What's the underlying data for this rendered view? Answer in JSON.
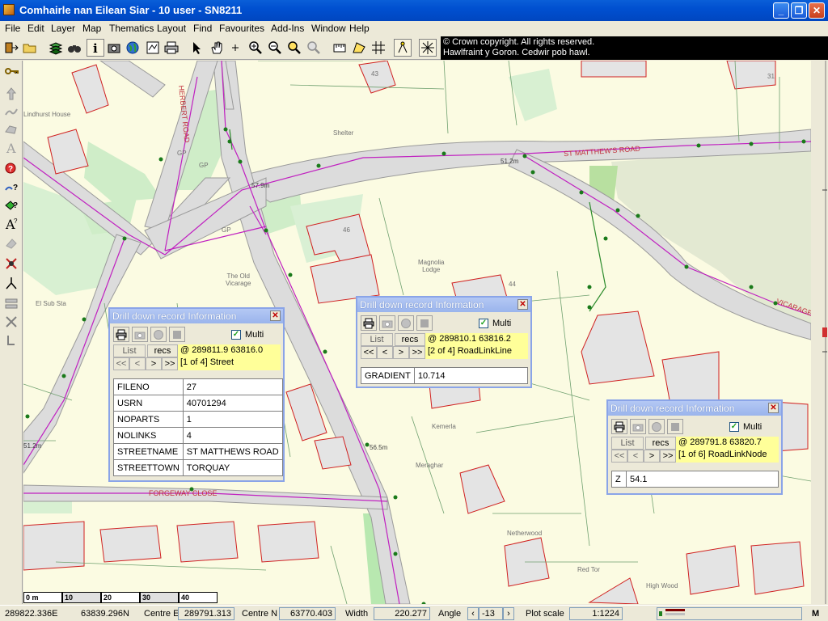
{
  "window": {
    "title": "Comhairle nan Eilean Siar - 10 user - SN8211"
  },
  "menu": [
    "File",
    "Edit",
    "Layer",
    "Map",
    "Thematics",
    "Layout",
    "Find",
    "Favourites",
    "Add-Ins",
    "Window",
    "Help"
  ],
  "copyright": {
    "line1": "© Crown copyright. All rights reserved.",
    "line2": "Hawlfraint y Goron. Cedwir pob hawl."
  },
  "map": {
    "labels": {
      "st_matthews_road": "ST MATTHEW'S ROAD",
      "herbert_road": "HERBERT ROAD",
      "forgeway_close": "FORGEWAY CLOSE",
      "vicarage": "VICARAGE",
      "shelter": "Shelter",
      "gp1": "GP",
      "gp2": "GP",
      "gp3": "GP",
      "old_vicarage": "The Old\nVicarage",
      "magnolia": "Magnolia\nLodge",
      "kemerla": "Kemerla",
      "meraghar": "Meraghar",
      "netherwood": "Netherwood",
      "red_tor": "Red Tor",
      "high_wood": "High Wood",
      "el_sub_sta": "El Sub Sta",
      "lindhurst": "Lindhurst House",
      "n43": "43",
      "n31": "31",
      "n46": "46",
      "n44": "44",
      "d1": "51.2m",
      "d2": "57.9m",
      "d3": "56.5m",
      "d4": "51.2m"
    },
    "scale_bar": [
      "0 m",
      "10",
      "20",
      "30",
      "40"
    ]
  },
  "dialogs": [
    {
      "title": "Drill down record Information",
      "multi_label": "Multi",
      "list_label": "List",
      "recs_label": "recs",
      "coord": "@ 289811.9 63816.0",
      "record": "[1 of 4] Street",
      "nav": [
        "<<",
        "<",
        ">",
        ">>"
      ],
      "rows": [
        {
          "key": "FILENO",
          "value": "27"
        },
        {
          "key": "USRN",
          "value": "40701294"
        },
        {
          "key": "NOPARTS",
          "value": "1"
        },
        {
          "key": "NOLINKS",
          "value": "4"
        },
        {
          "key": "STREETNAME",
          "value": "ST MATTHEWS ROAD"
        },
        {
          "key": "STREETTOWN",
          "value": "TORQUAY"
        }
      ]
    },
    {
      "title": "Drill down record Information",
      "multi_label": "Multi",
      "list_label": "List",
      "recs_label": "recs",
      "coord": "@ 289810.1 63816.2",
      "record": "[2 of 4] RoadLinkLine",
      "nav": [
        "<<",
        "<",
        ">",
        ">>"
      ],
      "rows": [
        {
          "key": "GRADIENT",
          "value": "10.714"
        }
      ]
    },
    {
      "title": "Drill down record Information",
      "multi_label": "Multi",
      "list_label": "List",
      "recs_label": "recs",
      "coord": "@ 289791.8 63820.7",
      "record": "[1 of 6] RoadLinkNode",
      "nav": [
        "<<",
        "<",
        ">",
        ">>"
      ],
      "rows": [
        {
          "key": "Z",
          "value": "54.1"
        }
      ]
    }
  ],
  "status": {
    "easting": "289822.336E",
    "northing": "63839.296N",
    "centre_e_label": "Centre E",
    "centre_e": "289791.313",
    "centre_n_label": "Centre N",
    "centre_n": "63770.403",
    "width_label": "Width",
    "width": "220.277",
    "angle_label": "Angle",
    "angle": "-13",
    "plot_scale_label": "Plot scale",
    "plot_scale": "1:1224",
    "m_label": "M"
  }
}
